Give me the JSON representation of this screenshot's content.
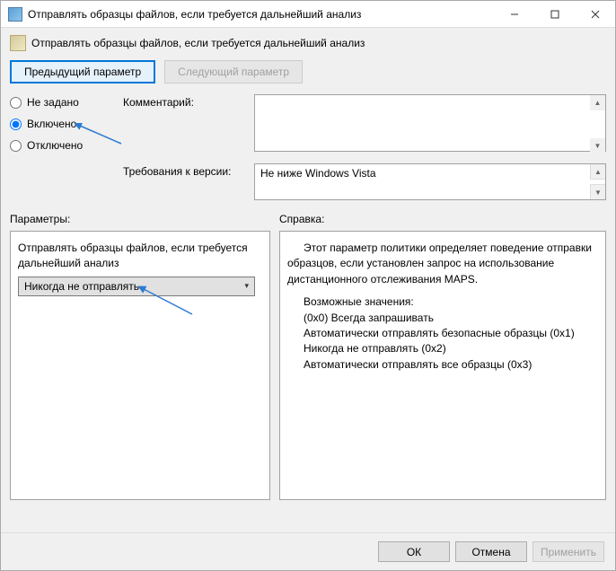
{
  "window": {
    "title": "Отправлять образцы файлов, если требуется дальнейший анализ"
  },
  "subtitle": "Отправлять образцы файлов, если требуется дальнейший анализ",
  "nav": {
    "prev": "Предыдущий параметр",
    "next": "Следующий параметр"
  },
  "state": {
    "not_configured": "Не задано",
    "enabled": "Включено",
    "disabled": "Отключено",
    "selected": "enabled"
  },
  "labels": {
    "comment": "Комментарий:",
    "requirements": "Требования к версии:",
    "parameters": "Параметры:",
    "help": "Справка:"
  },
  "requirements_value": "Не ниже Windows Vista",
  "parameters_panel": {
    "option_text": "Отправлять образцы файлов, если требуется дальнейший анализ",
    "combo_value": "Никогда не отправлять"
  },
  "help_panel": {
    "p1": "Этот параметр политики определяет поведение отправки образцов, если установлен запрос на использование дистанционного отслеживания MAPS.",
    "p2": "Возможные значения:",
    "li1": "(0x0) Всегда запрашивать",
    "li2": "Автоматически отправлять безопасные образцы (0x1)",
    "li3": "Никогда не отправлять (0x2)",
    "li4": "Автоматически отправлять все образцы (0x3)"
  },
  "footer": {
    "ok": "ОК",
    "cancel": "Отмена",
    "apply": "Применить"
  }
}
